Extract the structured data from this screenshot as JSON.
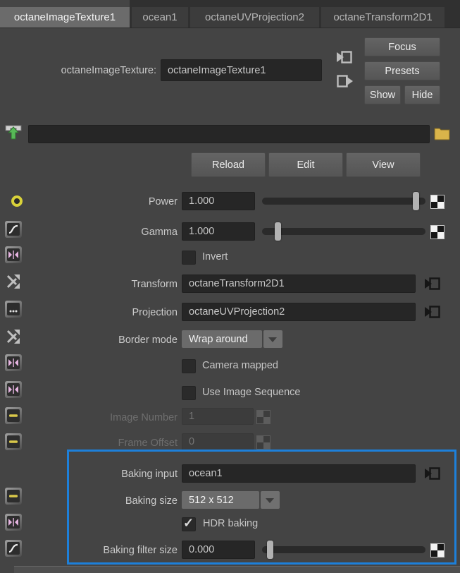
{
  "tabs": [
    {
      "label": "octaneImageTexture1",
      "active": true
    },
    {
      "label": "ocean1",
      "active": false
    },
    {
      "label": "octaneUVProjection2",
      "active": false
    },
    {
      "label": "octaneTransform2D1",
      "active": false
    }
  ],
  "header": {
    "type_label": "octaneImageTexture:",
    "name_value": "octaneImageTexture1",
    "focus_button": "Focus",
    "presets_button": "Presets",
    "show_button": "Show",
    "hide_button": "Hide"
  },
  "file": {
    "path_value": "",
    "reload_button": "Reload",
    "edit_button": "Edit",
    "view_button": "View"
  },
  "attributes": {
    "power": {
      "label": "Power",
      "value": "1.000",
      "slider_fraction": 0.96
    },
    "gamma": {
      "label": "Gamma",
      "value": "1.000",
      "slider_fraction": 0.08
    },
    "invert": {
      "label": "Invert",
      "checked": false
    },
    "transform": {
      "label": "Transform",
      "value": "octaneTransform2D1"
    },
    "projection": {
      "label": "Projection",
      "value": "octaneUVProjection2"
    },
    "border_mode": {
      "label": "Border mode",
      "value": "Wrap around"
    },
    "camera_mapped": {
      "label": "Camera mapped",
      "checked": false
    },
    "use_image_sequence": {
      "label": "Use Image Sequence",
      "checked": false
    },
    "image_number": {
      "label": "Image Number",
      "value": "1",
      "disabled": true
    },
    "frame_offset": {
      "label": "Frame Offset",
      "value": "0",
      "disabled": true
    },
    "baking_input": {
      "label": "Baking input",
      "value": "ocean1"
    },
    "baking_size": {
      "label": "Baking size",
      "value": "512 x 512"
    },
    "hdr_baking": {
      "label": "HDR baking",
      "checked": true
    },
    "baking_filter_size": {
      "label": "Baking filter size",
      "value": "0.000",
      "slider_fraction": 0.03
    }
  },
  "icons": {
    "header": [
      "input-connection-icon",
      "output-connection-icon"
    ],
    "file_row": [
      "texture-placement-icon",
      "folder-icon"
    ],
    "map_button": "checker-map-icon",
    "left_column": [
      "yellow-ring-icon",
      "curve-icon",
      "reverse-arrows-icon",
      "shuffle-arrows-icon",
      "dots-box-icon",
      "shuffle-arrows-icon",
      "reverse-arrows-icon",
      "reverse-arrows-icon",
      "range-bar-icon",
      "range-bar-icon",
      "range-bar-icon",
      "reverse-arrows-icon",
      "curve-icon"
    ]
  },
  "colors": {
    "background": "#444444",
    "field_background": "#262626",
    "active_tab": "#6b6b6b",
    "highlight_border": "#1d80da",
    "folder_yellow": "#d9b44a",
    "icon_yellow": "#d9d23a",
    "icon_pink": "#e5b3e0",
    "icon_green": "#57b957"
  }
}
